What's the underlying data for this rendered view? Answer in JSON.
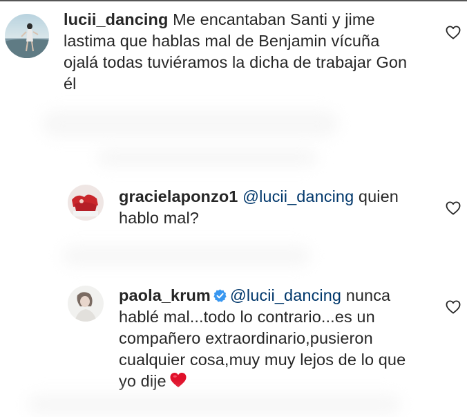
{
  "comments": [
    {
      "username": "lucii_dancing",
      "line1": "Me encantaban Santi y jime",
      "line2": "lastima que hablas mal de Benjamin vícuña",
      "line3": "ojalá todas tuviéramos la dicha de trabajar Gon",
      "line4": "él"
    }
  ],
  "replies": [
    {
      "username": "gracielaponzo1",
      "mention": "@lucii_dancing",
      "line1_rest": "quien",
      "line2": "hablo mal?"
    },
    {
      "username": "paola_krum",
      "verified": true,
      "mention": "@lucii_dancing",
      "line1_rest": "nunca",
      "line2": "hablé mal...todo lo contrario...es un",
      "line3": "compañero extraordinario,pusieron",
      "line4": "cualquier cosa,muy muy lejos de lo que",
      "line5": "yo dije",
      "emoji": "red-heart"
    }
  ],
  "icons": {
    "like": "heart-outline-icon",
    "verified": "verified-badge-icon"
  },
  "colors": {
    "text": "#262626",
    "mention": "#00376b",
    "verified": "#3897f0",
    "heart_emoji": "#e0102a"
  }
}
